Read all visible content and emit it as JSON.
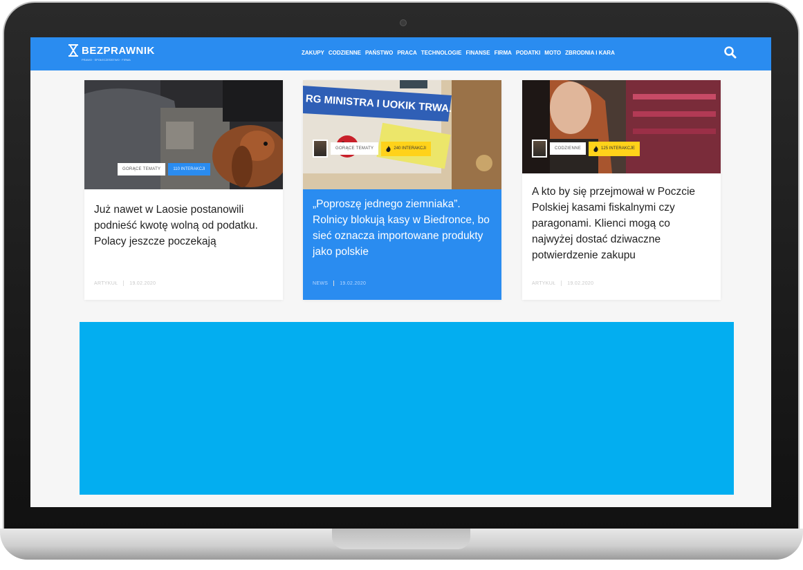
{
  "site": {
    "name": "BEZPRAWNIK",
    "tagline": "PRAWO · SPOŁECZEŃSTWO · FIRMA"
  },
  "nav": {
    "items": [
      "ZAKUPY",
      "CODZIENNE",
      "PAŃSTWO",
      "PRACA",
      "TECHNOLOGIE",
      "FINANSE",
      "FIRMA",
      "PODATKI",
      "MOTO",
      "ZBRODNIA I KARA"
    ]
  },
  "colors": {
    "brand": "#2a8cf0",
    "ad": "#03aef0",
    "interactions": "#ffd21a"
  },
  "cards": [
    {
      "category": "GORĄCE TEMATY",
      "interactions": "110 INTERAKCJI",
      "title": "Już nawet w Laosie postanowili podnieść kwotę wolną od podatku. Polacy jeszcze poczekają",
      "type": "ARTYKUŁ",
      "date": "19.02.2020"
    },
    {
      "category": "GORĄCE TEMATY",
      "interactions": "240 INTERAKCJI",
      "title": "„Poproszę jednego ziemniaka”. Rolnicy blokują kasy w Biedronce, bo sieć oznacza importowane produkty jako polskie",
      "type": "NEWS",
      "date": "19.02.2020"
    },
    {
      "category": "CODZIENNE",
      "interactions": "125 INTERAKCJE",
      "title": "A kto by się przejmował w Poczcie Polskiej kasami fiskalnymi czy paragonami. Klienci mogą co najwyżej dostać dziwaczne potwierdzenie zakupu",
      "type": "ARTYKUŁ",
      "date": "19.02.2020"
    }
  ],
  "images": {
    "card1": "dog-in-car-photo",
    "card2": "ministra-uokik-sign-photo",
    "card3": "woman-in-store-photo"
  }
}
